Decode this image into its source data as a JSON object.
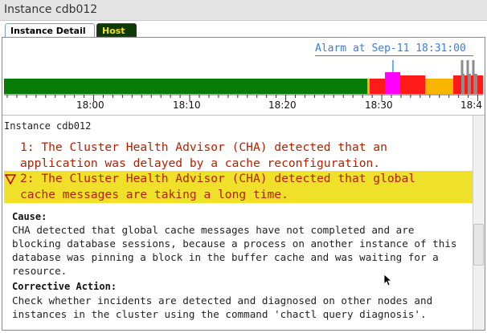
{
  "window": {
    "title": "Instance cdb012"
  },
  "tabs": [
    {
      "label": "Instance Detail",
      "active": true
    },
    {
      "label": "Host",
      "active": false
    }
  ],
  "timeline": {
    "alarm_text": "Alarm at Sep-11 18:31:00",
    "axis_labels": [
      "18:00",
      "18:10",
      "18:20",
      "18:30",
      "18:4"
    ],
    "status_colors": {
      "ok": "#067c06",
      "critical": "#ff1a1a",
      "warning": "#f7b400",
      "selected": "#ff00ff",
      "unknown": "#8c8c8c",
      "marker": "#3399ff"
    }
  },
  "detail": {
    "instance_label": "Instance cdb012",
    "incident_1": "1: The Cluster Health Advisor (CHA) detected that an\napplication was delayed by a cache reconfiguration.",
    "incident_2": "2: The Cluster Health Advisor (CHA) detected that global\ncache messages are taking a long time.",
    "cause_heading": "Cause:",
    "cause_text": "CHA detected that global cache messages have not completed and are\nblocking database sessions, because a process on another instance of this\ndatabase was pinning a block in the buffer cache and was waiting for a\nresource.",
    "action_heading": "Corrective Action:",
    "action_text": "Check whether incidents are detected and diagnosed on other nodes and\ninstances in the cluster using the command 'chactl query diagnosis'."
  }
}
